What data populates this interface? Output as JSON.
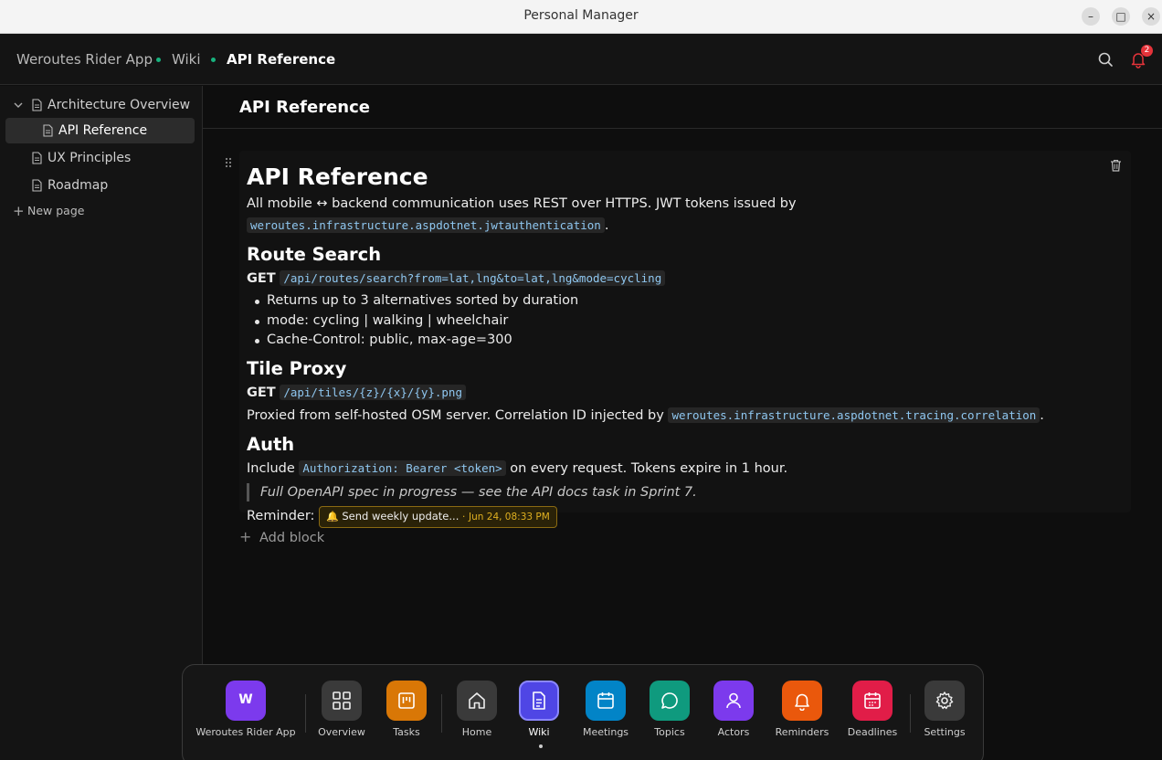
{
  "window": {
    "title": "Personal Manager",
    "buttons": [
      "–",
      "□",
      "×"
    ]
  },
  "header": {
    "breadcrumb": [
      "Weroutes Rider App",
      "Wiki",
      "API Reference"
    ],
    "notification_count": "2"
  },
  "sidebar": {
    "items": [
      {
        "label": "Architecture Overview",
        "expanded": true
      },
      {
        "label": "API Reference",
        "active": true
      },
      {
        "label": "UX Principles"
      },
      {
        "label": "Roadmap"
      }
    ],
    "new_page": "New page"
  },
  "main": {
    "page_title": "API Reference",
    "doc": {
      "h1": "API Reference",
      "intro_text": "All mobile ↔ backend communication uses REST over HTTPS. JWT tokens issued by",
      "intro_code": "weroutes.infrastructure.aspdotnet.jwtauthentication",
      "route_search": {
        "heading": "Route Search",
        "method": "GET",
        "endpoint": "/api/routes/search?from=lat,lng&to=lat,lng&mode=cycling",
        "bullets": [
          "Returns up to 3 alternatives sorted by duration",
          "mode: cycling | walking | wheelchair",
          "Cache-Control: public, max-age=300"
        ]
      },
      "tile_proxy": {
        "heading": "Tile Proxy",
        "method": "GET",
        "endpoint": "/api/tiles/{z}/{x}/{y}.png",
        "text": "Proxied from self-hosted OSM server. Correlation ID injected by",
        "code": "weroutes.infrastructure.aspdotnet.tracing.correlation"
      },
      "auth": {
        "heading": "Auth",
        "prefix": "Include",
        "code": "Authorization: Bearer <token>",
        "suffix": "on every request. Tokens expire in 1 hour."
      },
      "quote": "Full OpenAPI spec in progress — see the API docs task in Sprint 7.",
      "reminder": {
        "label": "Reminder:",
        "title": "Send weekly update...",
        "date": "Jun 24, 08:33 PM"
      }
    },
    "add_block": "Add block"
  },
  "dock": {
    "items": [
      {
        "label": "Weroutes Rider App",
        "letter": "W",
        "color": "#7c3aed"
      },
      {
        "label": "Overview",
        "color": "#3a3a3a"
      },
      {
        "label": "Tasks",
        "color": "#d97706"
      },
      {
        "label": "Home",
        "color": "#3a3a3a"
      },
      {
        "label": "Wiki",
        "color": "#4f46e5",
        "active": true
      },
      {
        "label": "Meetings",
        "color": "#0284c7"
      },
      {
        "label": "Topics",
        "color": "#0f9a7e"
      },
      {
        "label": "Actors",
        "color": "#7c3aed"
      },
      {
        "label": "Reminders",
        "color": "#ea580c"
      },
      {
        "label": "Deadlines",
        "color": "#e11d48"
      },
      {
        "label": "Settings",
        "color": "#3a3a3a"
      }
    ]
  }
}
